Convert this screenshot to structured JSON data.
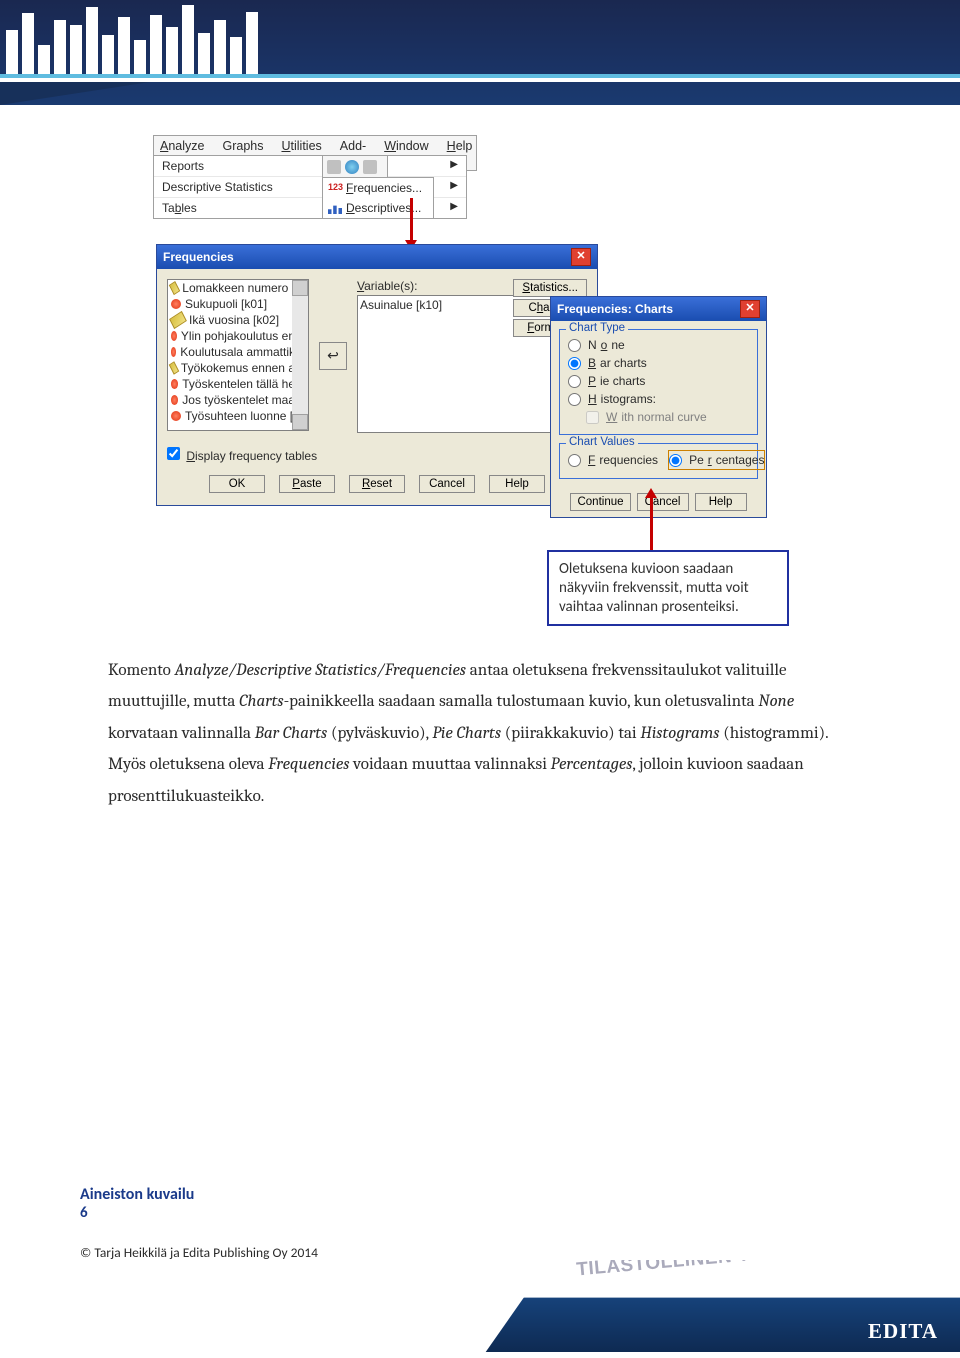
{
  "menubar": [
    "Analyze",
    "Graphs",
    "Utilities",
    "Add-ons",
    "Window",
    "Help"
  ],
  "menu_drop": [
    "Reports",
    "Descriptive Statistics",
    "Tables"
  ],
  "submenu": {
    "freq": "Frequencies...",
    "desc": "Descriptives...",
    "freq_ic": "123"
  },
  "freq_dialog": {
    "title": "Frequencies",
    "left_items": [
      {
        "t": "ruler",
        "label": "Lomakkeen numero [..."
      },
      {
        "t": "ball",
        "label": "Sukupuoli [k01]"
      },
      {
        "t": "ruler",
        "label": "Ikä vuosina [k02]"
      },
      {
        "t": "ball",
        "label": "Ylin pohjakoulutus en..."
      },
      {
        "t": "ball",
        "label": "Koulutusala ammattik..."
      },
      {
        "t": "ruler",
        "label": "Työkokemus ennen a..."
      },
      {
        "t": "ball",
        "label": "Työskentelen tällä he..."
      },
      {
        "t": "ball",
        "label": "Jos työskentelet maa..."
      },
      {
        "t": "ball",
        "label": "Työsuhteen luonne [..."
      }
    ],
    "variables_label": "Variable(s):",
    "variables_item": "Asuinalue [k10]",
    "side": [
      "Statistics...",
      "Charts...",
      "Format..."
    ],
    "checkbox": "Display frequency tables",
    "buttons": [
      "OK",
      "Paste",
      "Reset",
      "Cancel",
      "Help"
    ]
  },
  "charts_dialog": {
    "title": "Frequencies: Charts",
    "type_legend": "Chart Type",
    "types": {
      "none": "None",
      "bar": "Bar charts",
      "pie": "Pie charts",
      "hist": "Histograms:",
      "normal": "With normal curve"
    },
    "values_legend": "Chart Values",
    "values": {
      "freq": "Frequencies",
      "pct": "Percentages"
    },
    "buttons": [
      "Continue",
      "Cancel",
      "Help"
    ]
  },
  "callout": "Oletuksena kuvioon saadaan näkyviin frekvenssit, mutta voit vaihtaa valinnan prosenteiksi.",
  "body_html": "Komento <em>Analyze/Descriptive Statistics/Frequencies</em> antaa oletuksena frekvenssitaulukot valituille muuttujille, mutta <em>Charts</em>-painikkeella saadaan samalla tulostumaan kuvio, kun oletusvalinta <em>None</em> korvataan valinnalla <em>Bar Charts</em> (pylväskuvio), <em>Pie Charts</em> (piirakkakuvio) tai <em>Histograms</em> (histogrammi). Myös oletuksena oleva <em>Frequencies</em> voidaan muuttaa valinnaksi <em>Percentages</em>, jolloin kuvioon saadaan prosenttilukuasteikko.",
  "footer": {
    "title": "Aineiston kuvailu",
    "page": "6",
    "copy": "© Tarja Heikkilä ja Edita Publishing Oy 2014",
    "tilast": "TILASTOLLINEN TUTKIMUS",
    "edita": "EDITA"
  }
}
